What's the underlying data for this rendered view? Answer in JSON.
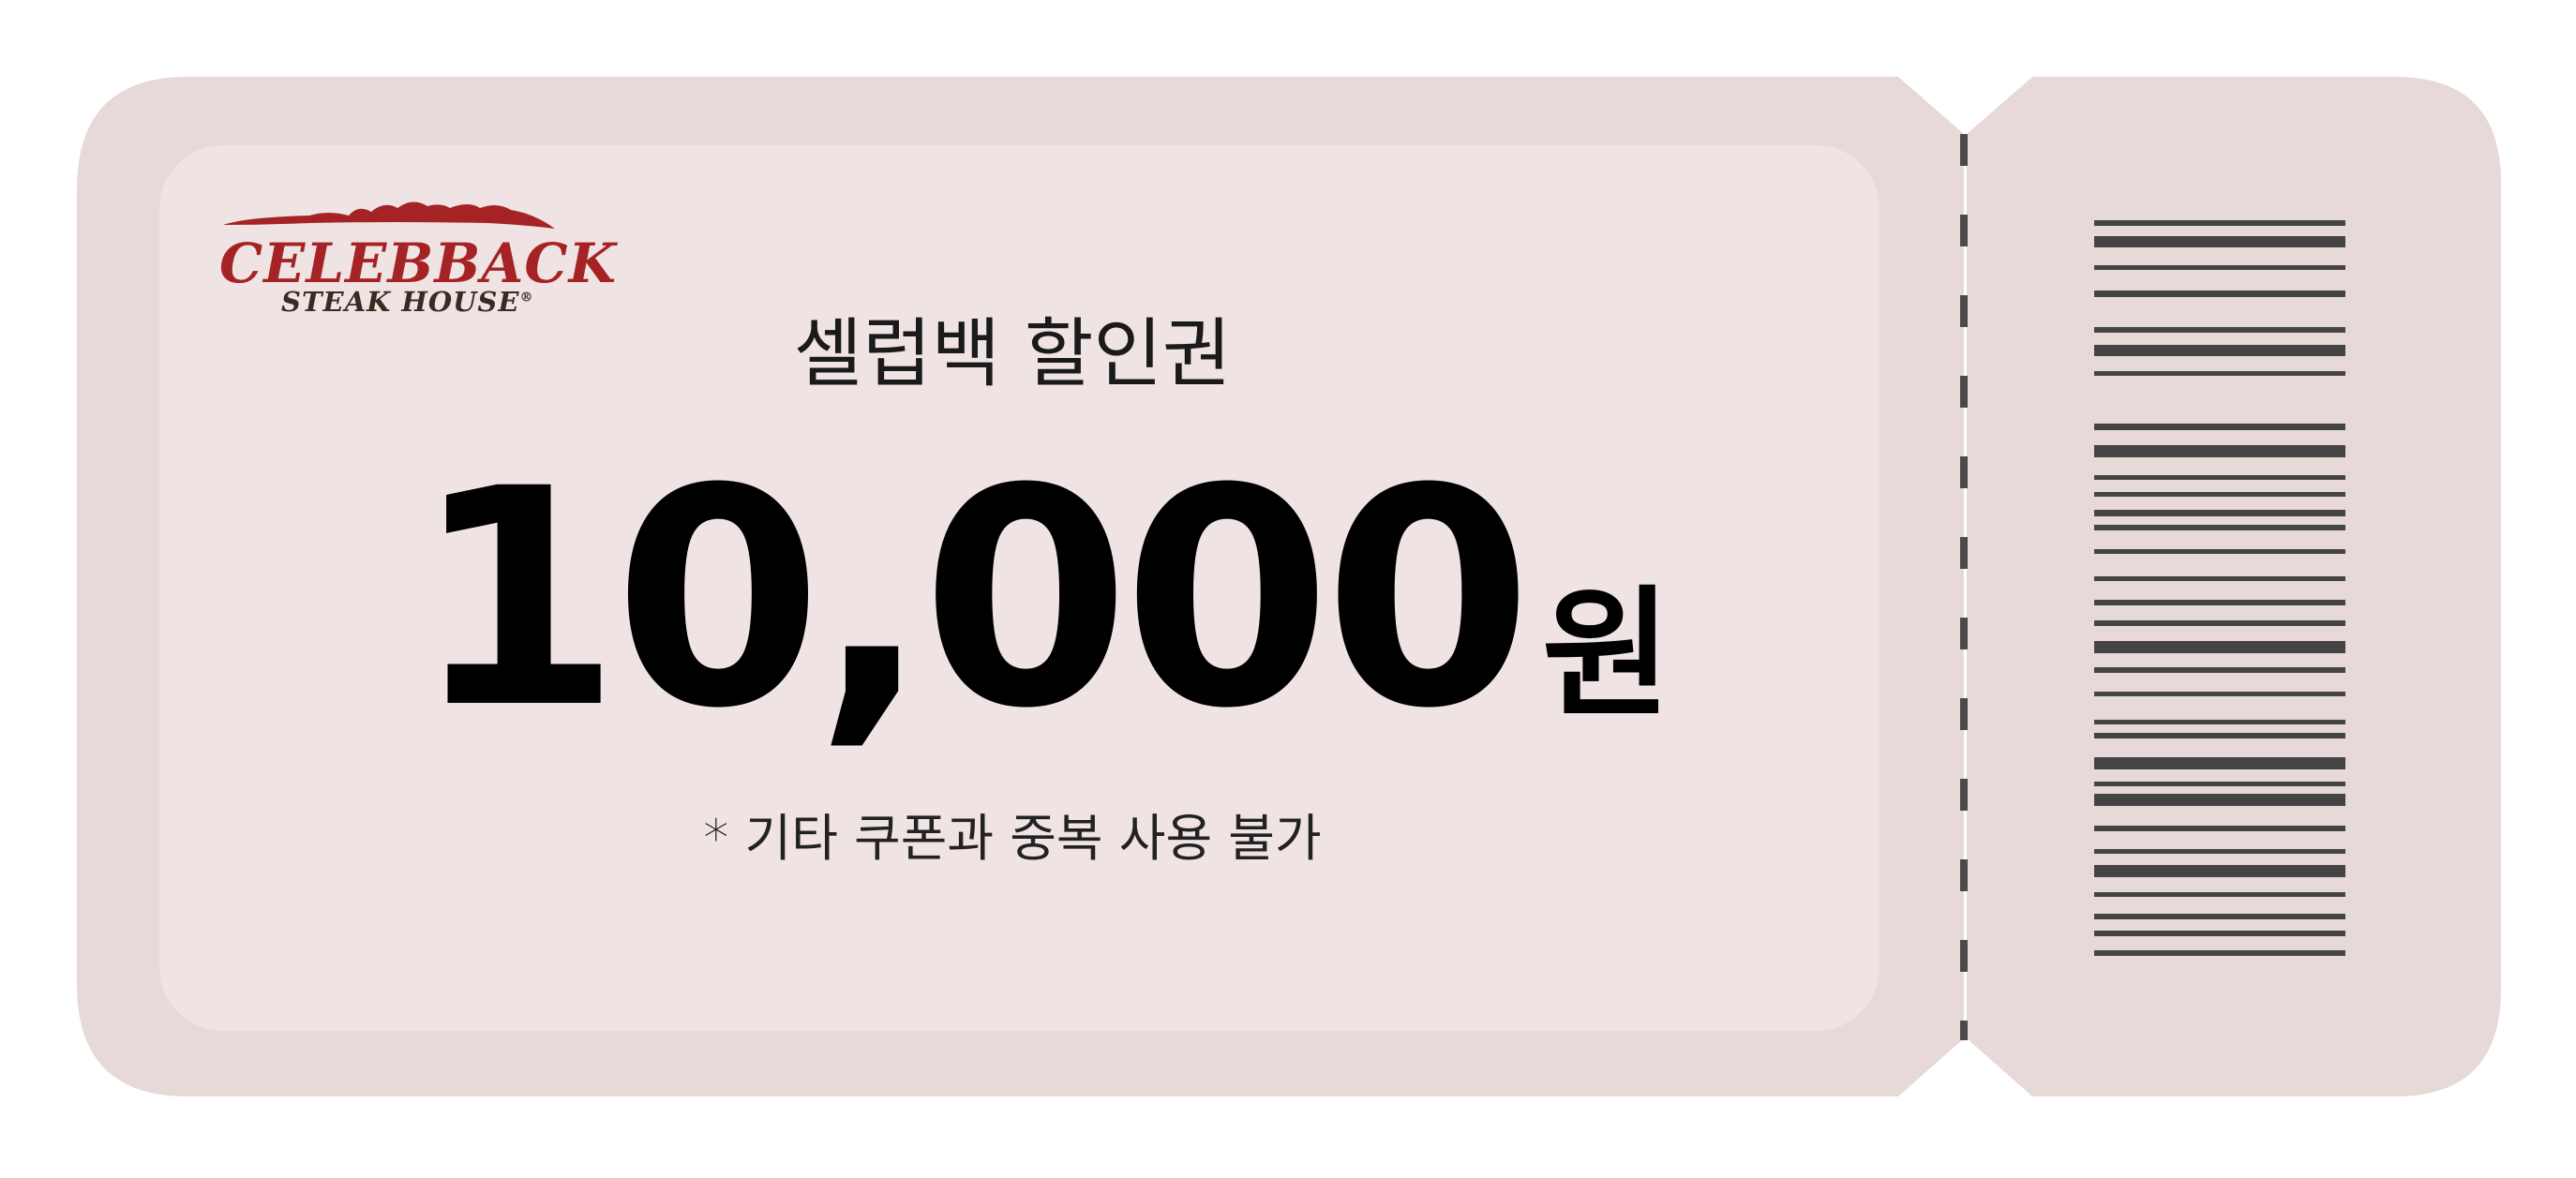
{
  "brand": {
    "name": "CELEBBACK",
    "subtitle": "STEAK HOUSE",
    "registered_mark": "®",
    "primary_color": "#a62325",
    "secondary_color": "#3a2a22"
  },
  "coupon": {
    "title": "셀럽백 할인권",
    "amount": "10,000",
    "currency": "원",
    "notice": "* 기타 쿠폰과 중복 사용 불가"
  },
  "colors": {
    "ticket_outer": "#e6d9d7",
    "ticket_inner": "#efe4e3",
    "perforation": "#4a4a4a",
    "barcode": "#444444"
  },
  "icons": {
    "logo": "celebback-logo",
    "barcode": "barcode-icon"
  }
}
